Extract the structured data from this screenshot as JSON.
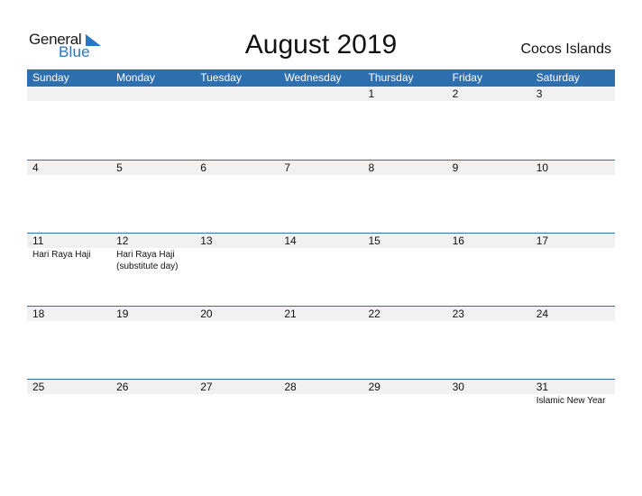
{
  "logo": {
    "word1": "General",
    "word2": "Blue"
  },
  "title": "August 2019",
  "country": "Cocos Islands",
  "colors": {
    "accent": "#2e6fb0",
    "band": "#f1f1f1",
    "logo_blue": "#2a75c4"
  },
  "weekdays": [
    "Sunday",
    "Monday",
    "Tuesday",
    "Wednesday",
    "Thursday",
    "Friday",
    "Saturday"
  ],
  "weeks": [
    [
      {
        "n": "",
        "e": ""
      },
      {
        "n": "",
        "e": ""
      },
      {
        "n": "",
        "e": ""
      },
      {
        "n": "",
        "e": ""
      },
      {
        "n": "1",
        "e": ""
      },
      {
        "n": "2",
        "e": ""
      },
      {
        "n": "3",
        "e": ""
      }
    ],
    [
      {
        "n": "4",
        "e": ""
      },
      {
        "n": "5",
        "e": ""
      },
      {
        "n": "6",
        "e": ""
      },
      {
        "n": "7",
        "e": ""
      },
      {
        "n": "8",
        "e": ""
      },
      {
        "n": "9",
        "e": ""
      },
      {
        "n": "10",
        "e": ""
      }
    ],
    [
      {
        "n": "11",
        "e": "Hari Raya Haji"
      },
      {
        "n": "12",
        "e": "Hari Raya Haji (substitute day)"
      },
      {
        "n": "13",
        "e": ""
      },
      {
        "n": "14",
        "e": ""
      },
      {
        "n": "15",
        "e": ""
      },
      {
        "n": "16",
        "e": ""
      },
      {
        "n": "17",
        "e": ""
      }
    ],
    [
      {
        "n": "18",
        "e": ""
      },
      {
        "n": "19",
        "e": ""
      },
      {
        "n": "20",
        "e": ""
      },
      {
        "n": "21",
        "e": ""
      },
      {
        "n": "22",
        "e": ""
      },
      {
        "n": "23",
        "e": ""
      },
      {
        "n": "24",
        "e": ""
      }
    ],
    [
      {
        "n": "25",
        "e": ""
      },
      {
        "n": "26",
        "e": ""
      },
      {
        "n": "27",
        "e": ""
      },
      {
        "n": "28",
        "e": ""
      },
      {
        "n": "29",
        "e": ""
      },
      {
        "n": "30",
        "e": ""
      },
      {
        "n": "31",
        "e": "Islamic New Year"
      }
    ]
  ]
}
